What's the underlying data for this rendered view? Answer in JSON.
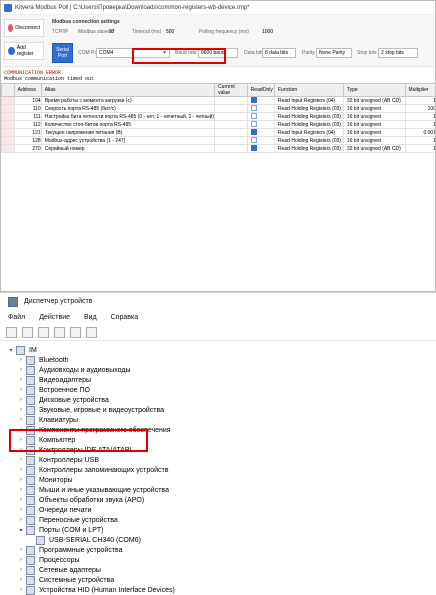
{
  "modbus": {
    "title": "Kitvera Modbus Poll | C:\\Users\\Проверка\\Downloads\\common-registers-wb-device.rmp*",
    "toolbar": {
      "disconnect": "Disconnect",
      "add_register": "Add register"
    },
    "settings": {
      "heading": "Modbus connection settings",
      "tcpip": "TCP/IP",
      "slave_id_label": "Modbus slave id",
      "slave_id": "87",
      "timeout_label": "Timeout (ms)",
      "timeout": "500",
      "polling_label": "Polling frequency (ms)",
      "polling": "1000",
      "serial_port_btn": "Serial Port",
      "com_label": "COM Port",
      "com_value": "COM4",
      "baud_label": "Baud rate",
      "baud_value": "9600 baud",
      "databits_label": "Data bits",
      "databits_value": "8 data bits",
      "parity_label": "Parity",
      "parity_value": "None Parity",
      "stopbits_label": "Stop bits",
      "stopbits_value": "2 stop bits"
    },
    "error": {
      "title": "COMMUNICATION ERROR",
      "message": "Modbus communication timed out"
    },
    "table": {
      "headers": [
        "",
        "Address",
        "Alias",
        "Current value",
        "ReadOnly",
        "Function",
        "Type",
        "Multiplier"
      ],
      "rows": [
        {
          "address": "104",
          "alias": "Время работы с момента загрузки (с)",
          "value": "",
          "readonly": true,
          "function": "Read Input Registers (04)",
          "type": "32 bit unsigned (AB CD)",
          "mult": "1"
        },
        {
          "address": "110",
          "alias": "Скорость порта RS-485 (бит/с)",
          "value": "",
          "readonly": false,
          "function": "Read Holding Registers (03)",
          "type": "16 bit unsigned",
          "mult": "100"
        },
        {
          "address": "111",
          "alias": "Настройка бита четности порта RS-485 (0 - нет, 1 - нечетный, 2 - четный)",
          "value": "",
          "readonly": false,
          "function": "Read Holding Registers (03)",
          "type": "16 bit unsigned",
          "mult": "1"
        },
        {
          "address": "112",
          "alias": "Количество стоп-битов порта RS-485",
          "value": "",
          "readonly": false,
          "function": "Read Holding Registers (03)",
          "type": "16 bit unsigned",
          "mult": "1"
        },
        {
          "address": "121",
          "alias": "Текущее напряжение питания (В)",
          "value": "",
          "readonly": true,
          "function": "Read Input Registers (04)",
          "type": "16 bit unsigned",
          "mult": "0.001"
        },
        {
          "address": "128",
          "alias": "Modbus-адрес устройства (1 - 247)",
          "value": "",
          "readonly": false,
          "function": "Read Holding Registers (03)",
          "type": "16 bit unsigned",
          "mult": "1"
        },
        {
          "address": "270",
          "alias": "Серийный номер",
          "value": "",
          "readonly": true,
          "function": "Read Holding Registers (03)",
          "type": "32 bit unsigned (AB CD)",
          "mult": "1"
        }
      ]
    }
  },
  "device_manager": {
    "title": "Диспетчер устройств",
    "menu": [
      "Файл",
      "Действие",
      "Вид",
      "Справка"
    ],
    "root": "IM",
    "items": [
      "Bluetooth",
      "Аудиовходы и аудиовыходы",
      "Видеоадаптеры",
      "Встроенное ПО",
      "Дисковые устройства",
      "Звуковые, игровые и видеоустройства",
      "Клавиатуры",
      "Компоненты программного обеспечения",
      "Компьютер",
      "Контроллеры IDE ATA/ATAPI",
      "Контроллеры USB",
      "Контроллеры запоминающих устройств",
      "Мониторы",
      "Мыши и иные указывающие устройства",
      "Объекты обработки звука (APO)",
      "Очереди печати",
      "Переносные устройства",
      "Порты (COM и LPT)",
      "Программные устройства",
      "Процессоры",
      "Сетевые адаптеры",
      "Системные устройства",
      "Устройства HID (Human Interface Devices)"
    ],
    "ports_child": "USB-SERIAL CH340 (COM6)"
  },
  "colors": {
    "red": "#e00000",
    "blue": "#2d6fd6",
    "pink": "#fbe5e5"
  }
}
